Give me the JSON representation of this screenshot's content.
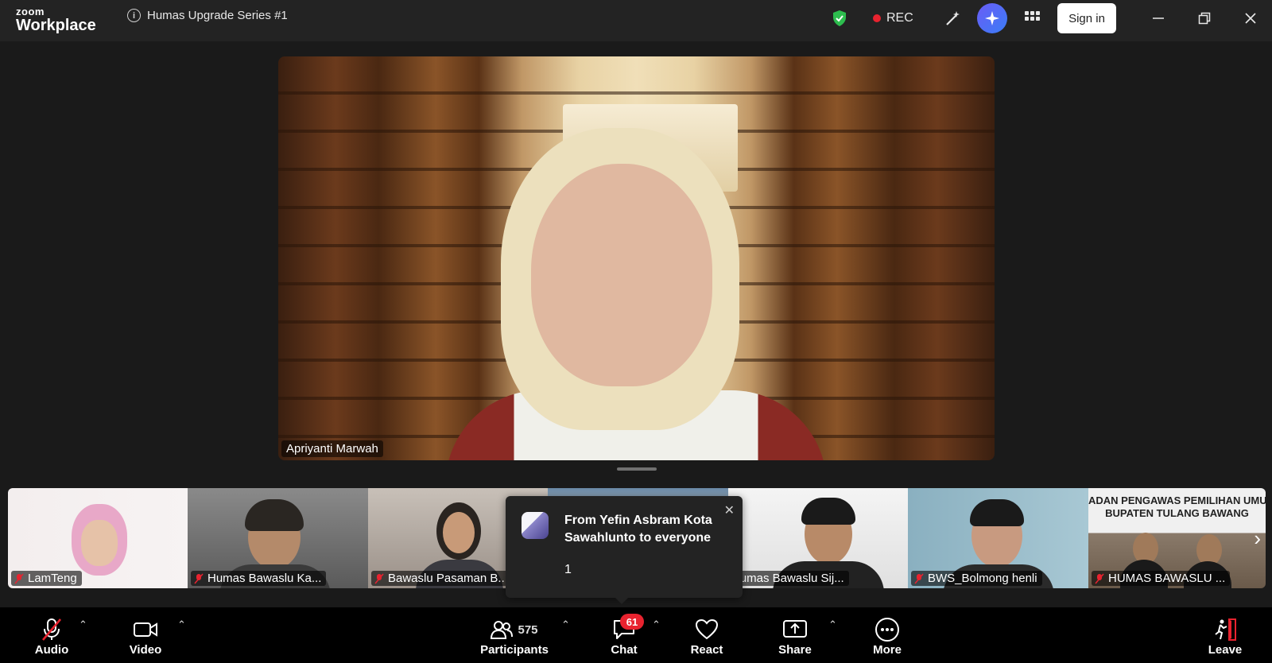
{
  "app": {
    "brand_top": "zoom",
    "brand_bottom": "Workplace"
  },
  "meeting": {
    "title": "Humas Upgrade Series #1"
  },
  "titlebar": {
    "rec_label": "REC",
    "signin_label": "Sign in",
    "colors": {
      "shield": "#2dbd4e",
      "rec": "#e8232f",
      "ai": "#5b6cf6"
    }
  },
  "speaker": {
    "name": "Apriyanti Marwah"
  },
  "thumbnails": [
    {
      "name": "LamTeng"
    },
    {
      "name": "Humas Bawaslu Ka..."
    },
    {
      "name": "Bawaslu Pasaman B..."
    },
    {
      "name": ""
    },
    {
      "name": "Humas Bawaslu Sij..."
    },
    {
      "name": "BWS_Bolmong henli"
    },
    {
      "name": "HUMAS BAWASLU ..."
    }
  ],
  "banner_text": "ADAN PENGAWAS PEMILIHAN UMUM\nBUPATEN TULANG BAWANG",
  "chat_popup": {
    "from": "From Yefin Asbram Kota Sawahlunto to everyone",
    "message": "1"
  },
  "toolbar": {
    "audio": "Audio",
    "video": "Video",
    "participants": "Participants",
    "participant_count": "575",
    "chat": "Chat",
    "chat_badge": "61",
    "react": "React",
    "share": "Share",
    "more": "More",
    "leave": "Leave"
  }
}
